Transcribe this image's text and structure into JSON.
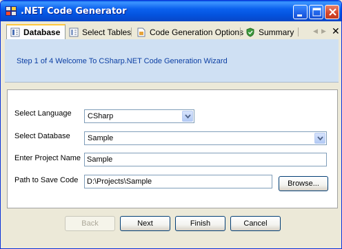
{
  "window": {
    "title": ".NET Code Generator",
    "icon": "app-grid-icon"
  },
  "tabs": [
    {
      "label": "Database",
      "icon": "database-icon",
      "active": true
    },
    {
      "label": "Select Tables",
      "icon": "table-icon",
      "active": false
    },
    {
      "label": "Code Generation Options",
      "icon": "options-page-icon",
      "active": false
    },
    {
      "label": "Summary",
      "icon": "summary-shield-icon",
      "active": false
    }
  ],
  "header": {
    "step_text": "Step 1 of 4 Welcome To CSharp.NET Code Generation Wizard"
  },
  "form": {
    "language_label": "Select Language",
    "language_value": "CSharp",
    "database_label": "Select Database",
    "database_value": "Sample",
    "project_label": "Enter Project Name",
    "project_value": "Sample",
    "path_label": "Path to Save Code",
    "path_value": "D:\\Projects\\Sample",
    "browse_label": "Browse..."
  },
  "buttons": {
    "back": "Back",
    "next": "Next",
    "finish": "Finish",
    "cancel": "Cancel"
  },
  "colors": {
    "titlebar": "#0b61ee",
    "header_bg": "#cfe0f3",
    "step_text": "#0b3ea3",
    "active_tab_accent": "#ffc83c"
  }
}
